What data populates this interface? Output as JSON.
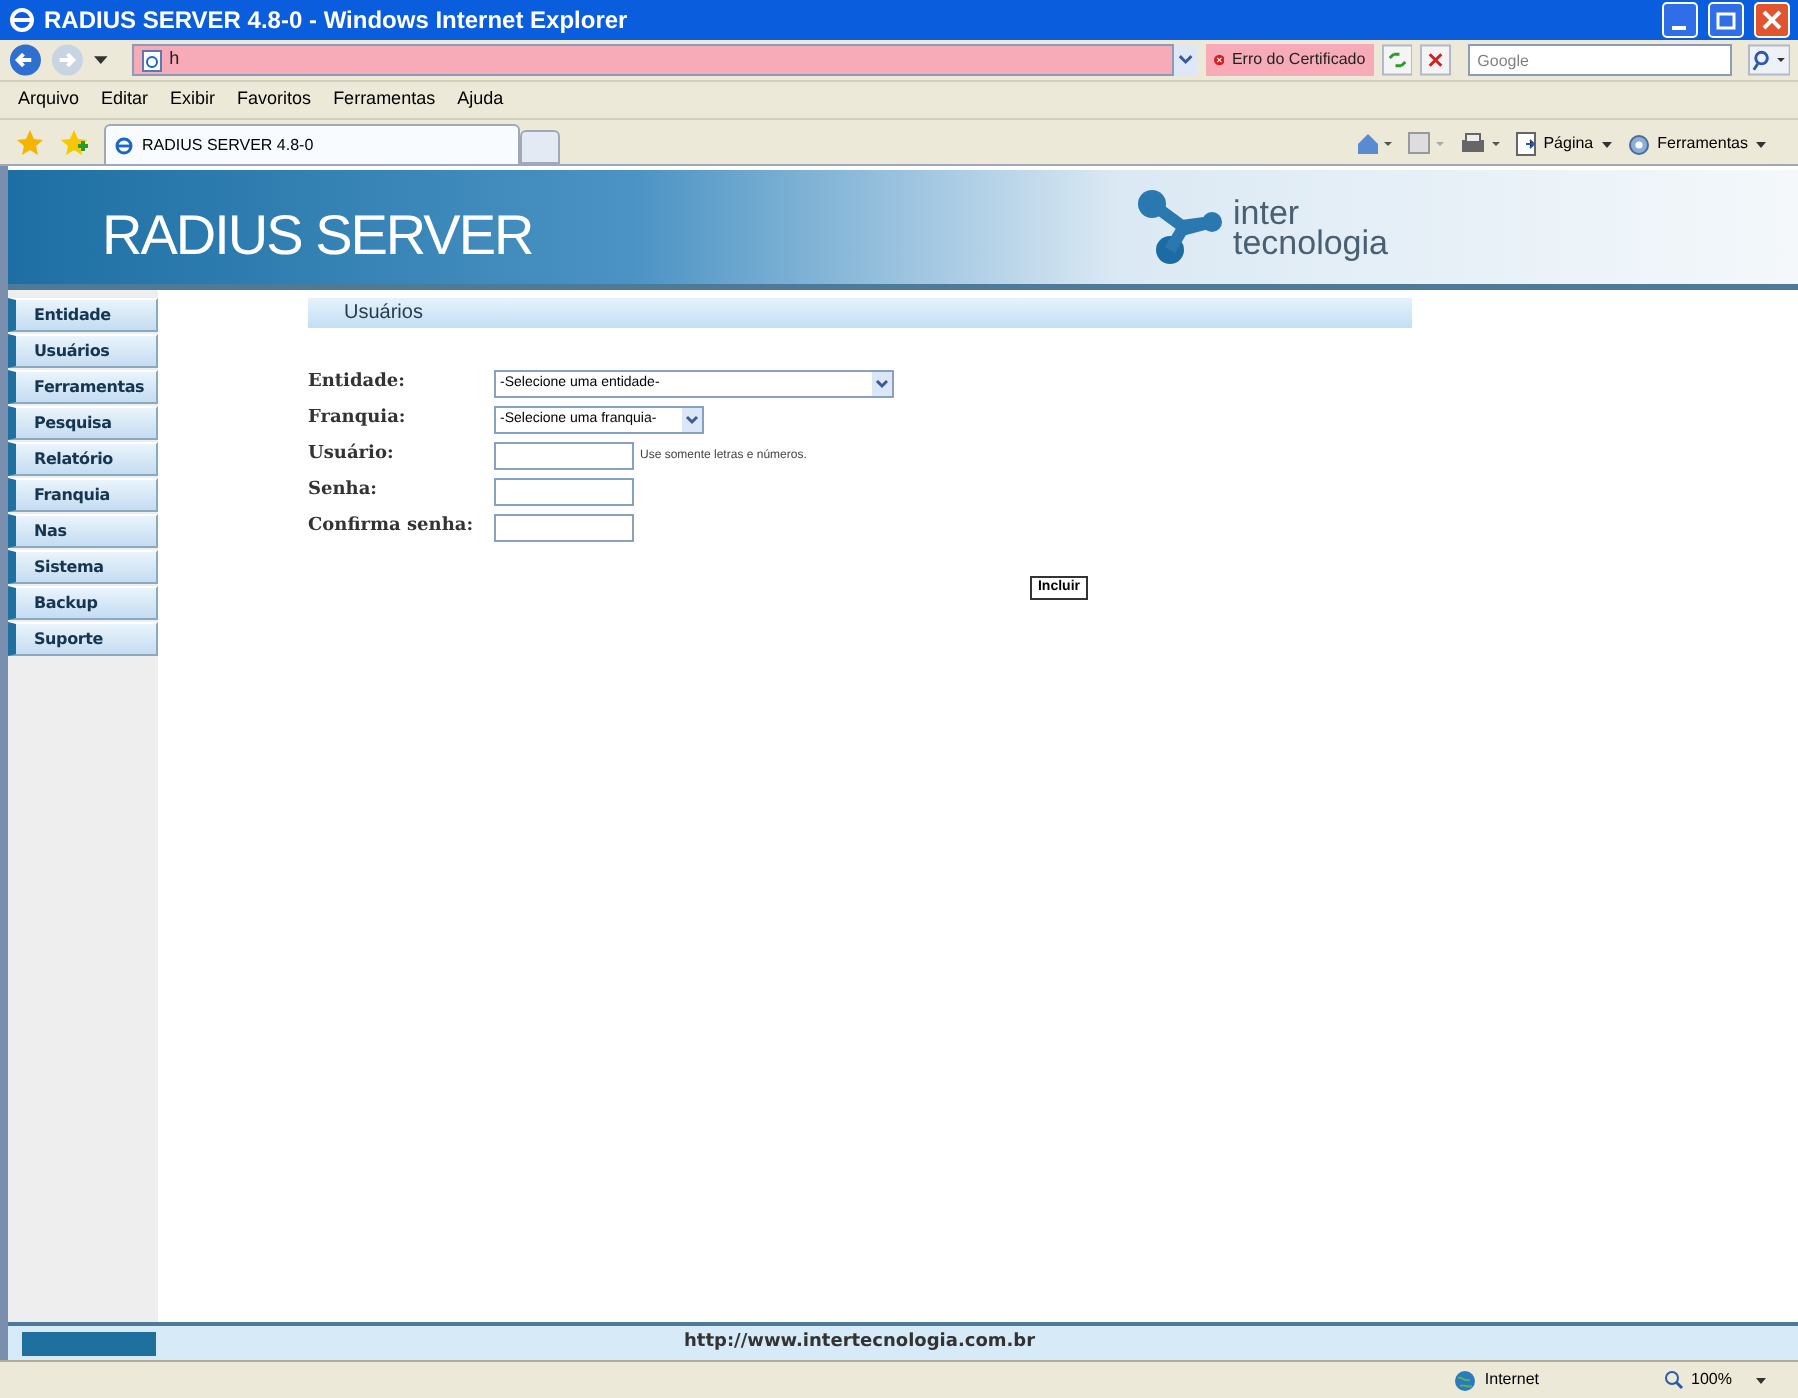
{
  "window": {
    "title": "RADIUS SERVER 4.8-0 - Windows Internet Explorer"
  },
  "address_bar": {
    "value": "h",
    "certificate_error": "Erro do Certificado"
  },
  "search": {
    "placeholder": "Google"
  },
  "menu": [
    "Arquivo",
    "Editar",
    "Exibir",
    "Favoritos",
    "Ferramentas",
    "Ajuda"
  ],
  "tab": {
    "title": "RADIUS SERVER 4.8-0"
  },
  "command_bar": [
    {
      "kind": "page",
      "label": "Página"
    },
    {
      "kind": "tools",
      "label": "Ferramentas"
    }
  ],
  "page": {
    "banner_title": "RADIUS SERVER",
    "logo_lines": [
      "inter",
      "tecnologia"
    ],
    "nav": [
      "Entidade",
      "Usuários",
      "Ferramentas",
      "Pesquisa",
      "Relatório",
      "Franquia",
      "Nas",
      "Sistema",
      "Backup",
      "Suporte"
    ],
    "section_title": "Usuários",
    "fields": [
      {
        "kind": "select",
        "label": "Entidade:",
        "value": "-Selecione uma entidade-",
        "wide": true
      },
      {
        "kind": "select",
        "label": "Franquia:",
        "value": "-Selecione uma franquia-",
        "wide": false
      },
      {
        "kind": "text",
        "label": "Usuário:",
        "hint": "Use somente letras e números."
      },
      {
        "kind": "text",
        "label": "Senha:"
      },
      {
        "kind": "text",
        "label": "Confirma senha:"
      }
    ],
    "submit": "Incluir",
    "footer_url": "http://www.intertecnologia.com.br"
  },
  "status_bar": {
    "zone": "Internet",
    "zoom": "100%"
  }
}
